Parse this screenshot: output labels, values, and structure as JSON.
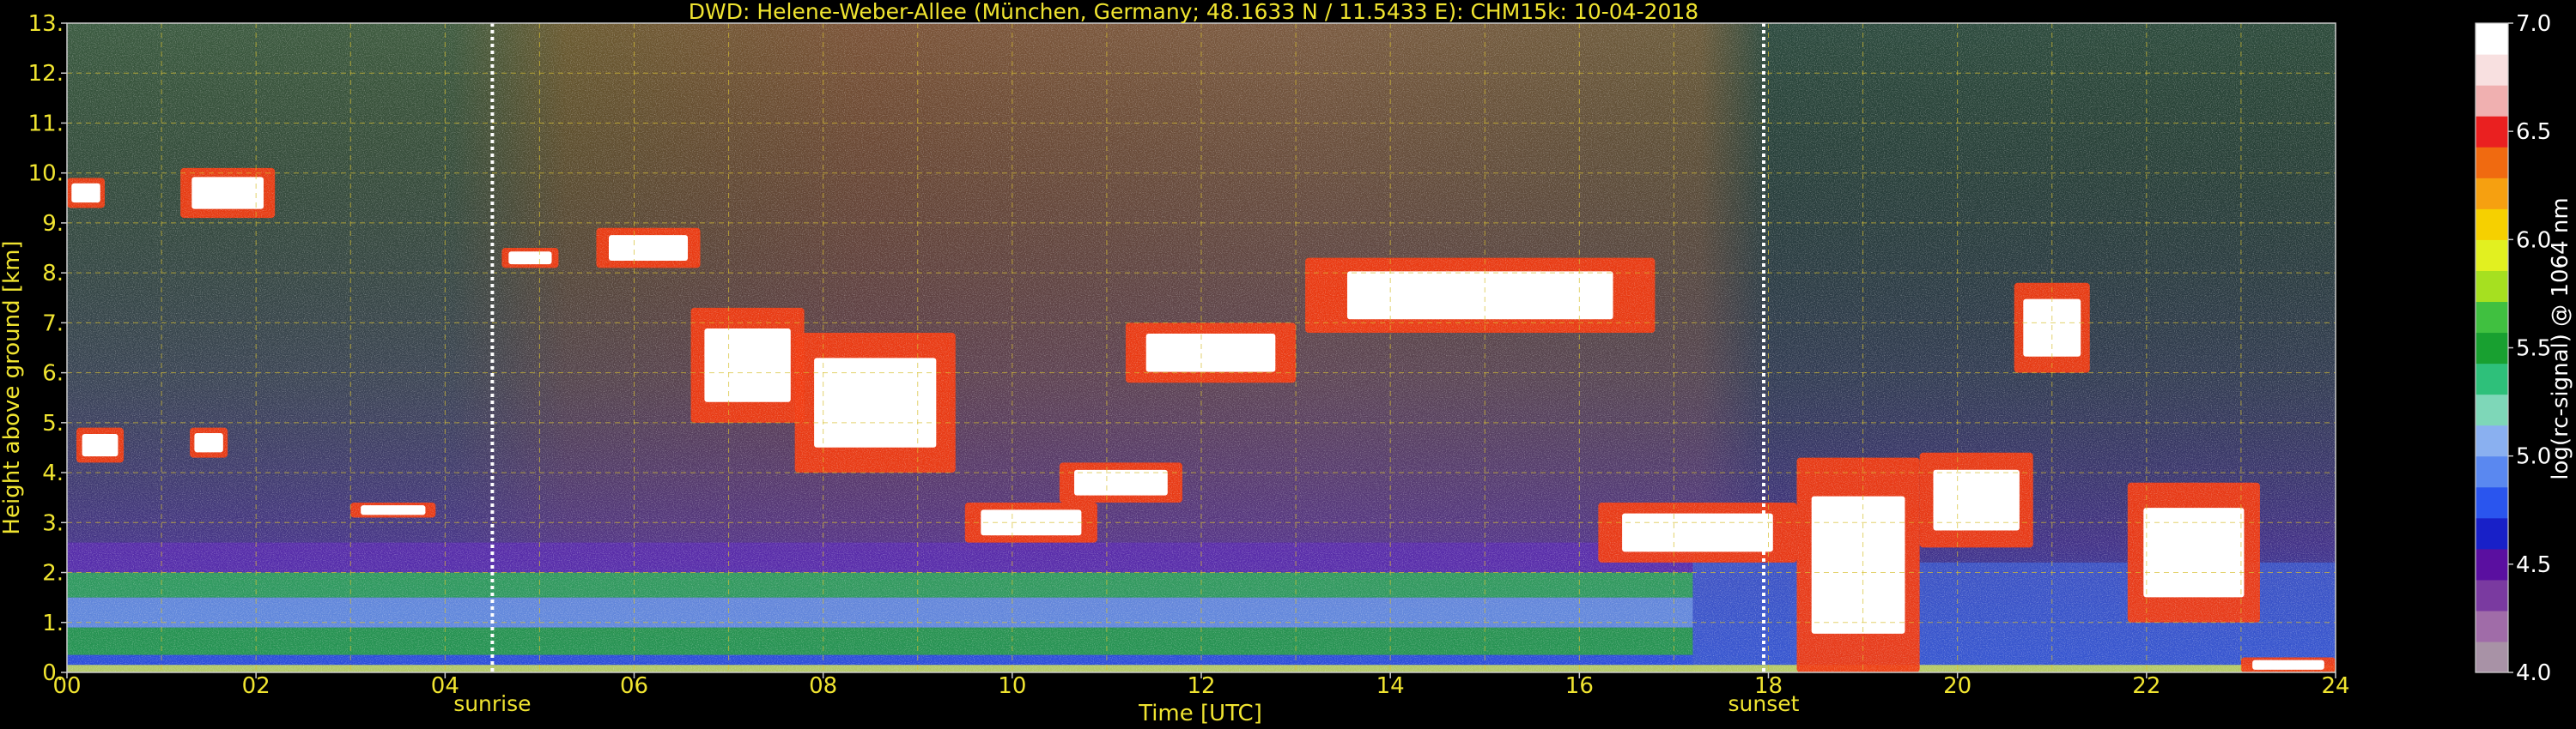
{
  "chart_data": {
    "type": "heatmap",
    "title": "DWD: Helene-Weber-Allee (München, Germany; 48.1633 N / 11.5433 E):    CHM15k: 10-04-2018",
    "xlabel": "Time [UTC]",
    "ylabel": "Height above ground [km]",
    "xlim": [
      0,
      24
    ],
    "ylim": [
      0,
      13
    ],
    "x_ticks": [
      "00",
      "02",
      "04",
      "06",
      "08",
      "10",
      "12",
      "14",
      "16",
      "18",
      "20",
      "22",
      "24"
    ],
    "y_ticks": [
      "0.",
      "1.",
      "2.",
      "3.",
      "4.",
      "5.",
      "6.",
      "7.",
      "8.",
      "9.",
      "10.",
      "11.",
      "12.",
      "13."
    ],
    "grid": true,
    "markers": [
      {
        "label": "sunrise",
        "time": 4.5
      },
      {
        "label": "sunset",
        "time": 17.95
      }
    ],
    "colorbar": {
      "label": "log(rc-signal) @ 1064 nm",
      "range": [
        4.0,
        7.0
      ],
      "ticks": [
        "4.0",
        "4.5",
        "5.0",
        "5.5",
        "6.0",
        "6.5",
        "7.0"
      ],
      "colors": [
        "#a892a6",
        "#a06ca8",
        "#7a3aa0",
        "#5a0fa0",
        "#1820c8",
        "#2a55ee",
        "#5a88f0",
        "#8ab0f0",
        "#7ed7b8",
        "#2ec07a",
        "#18a030",
        "#40c040",
        "#a6e020",
        "#e2f020",
        "#f6d000",
        "#f6a010",
        "#f06a10",
        "#ea2020",
        "#f0b0b0",
        "#f8e0e0",
        "#ffffff"
      ]
    },
    "cloud_layers": [
      {
        "name": "high-cloud-morning",
        "t0": 1.2,
        "t1": 2.2,
        "h0": 9.1,
        "h1": 10.1
      },
      {
        "name": "high-cloud-left",
        "t0": 0.0,
        "t1": 0.4,
        "h0": 9.3,
        "h1": 9.9
      },
      {
        "name": "mid-cloud-early",
        "t0": 0.1,
        "t1": 0.6,
        "h0": 4.2,
        "h1": 4.9
      },
      {
        "name": "mid-cloud-early-2",
        "t0": 1.3,
        "t1": 1.7,
        "h0": 4.3,
        "h1": 4.9
      },
      {
        "name": "cloud-0430",
        "t0": 3.0,
        "t1": 3.9,
        "h0": 3.1,
        "h1": 3.4
      },
      {
        "name": "cloud-0500",
        "t0": 4.6,
        "t1": 5.2,
        "h0": 8.1,
        "h1": 8.5
      },
      {
        "name": "cloud-0600",
        "t0": 5.6,
        "t1": 6.7,
        "h0": 8.1,
        "h1": 8.9
      },
      {
        "name": "cloud-0700",
        "t0": 6.6,
        "t1": 7.8,
        "h0": 5.0,
        "h1": 7.3
      },
      {
        "name": "cloud-0800",
        "t0": 7.7,
        "t1": 9.4,
        "h0": 4.0,
        "h1": 6.8
      },
      {
        "name": "cloud-1000",
        "t0": 9.5,
        "t1": 10.9,
        "h0": 2.6,
        "h1": 3.4
      },
      {
        "name": "cloud-1100",
        "t0": 10.5,
        "t1": 11.8,
        "h0": 3.4,
        "h1": 4.2
      },
      {
        "name": "cloud-1200",
        "t0": 11.2,
        "t1": 13.0,
        "h0": 5.8,
        "h1": 7.0
      },
      {
        "name": "cloud-1400",
        "t0": 13.1,
        "t1": 16.8,
        "h0": 6.8,
        "h1": 8.3
      },
      {
        "name": "cloud-1700",
        "t0": 16.2,
        "t1": 18.3,
        "h0": 2.2,
        "h1": 3.4
      },
      {
        "name": "cloud-1900",
        "t0": 18.3,
        "t1": 19.6,
        "h0": 0.0,
        "h1": 4.3
      },
      {
        "name": "cloud-2000",
        "t0": 19.6,
        "t1": 20.8,
        "h0": 2.5,
        "h1": 4.4
      },
      {
        "name": "cloud-2100",
        "t0": 20.6,
        "t1": 21.4,
        "h0": 6.0,
        "h1": 7.8
      },
      {
        "name": "cloud-2200",
        "t0": 21.8,
        "t1": 23.2,
        "h0": 1.0,
        "h1": 3.8
      },
      {
        "name": "boundary-layer-2400",
        "t0": 23.0,
        "t1": 24.0,
        "h0": 0.0,
        "h1": 0.3
      }
    ]
  }
}
